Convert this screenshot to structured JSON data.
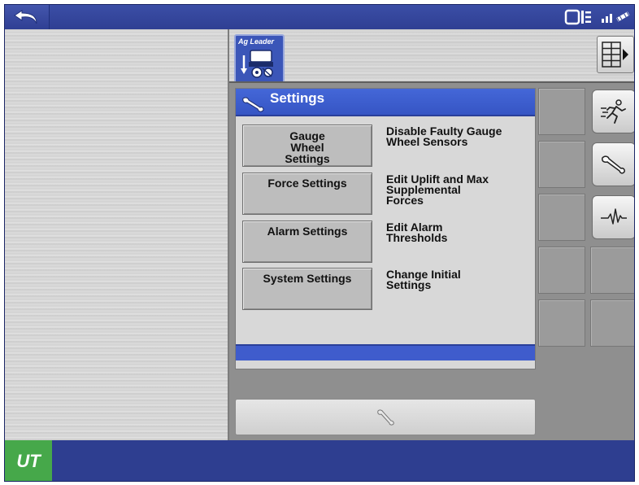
{
  "topbar": {
    "back_icon": "undo-arrow-icon",
    "status_icons": [
      "implement-status-icon",
      "gps-satellite-icon"
    ]
  },
  "ag_tab": {
    "logo_text": "Ag Leader",
    "icon": "planter-icon"
  },
  "grid_button": {
    "icon": "layout-grid-icon"
  },
  "settings": {
    "title": "Settings",
    "title_icon": "wrench-icon",
    "rows": [
      {
        "button_label": "Gauge Wheel Settings",
        "description": "Disable Faulty Gauge Wheel Sensors"
      },
      {
        "button_label": "Force Settings",
        "description": "Edit Uplift and Max Supplemental Forces"
      },
      {
        "button_label": "Alarm Settings",
        "description": "Edit Alarm Thresholds"
      },
      {
        "button_label": "System Settings",
        "description": "Change Initial Settings"
      }
    ]
  },
  "bottom_button": {
    "icon": "wrench-icon"
  },
  "side_buttons": [
    {
      "icon": "running-person-icon"
    },
    {
      "icon": "wrench-icon"
    },
    {
      "icon": "pulse-waveform-icon"
    }
  ],
  "bottombar": {
    "ut_label": "UT"
  },
  "colors": {
    "bar_blue": "#2e3e90",
    "header_blue": "#3f5ccc",
    "ut_green": "#46a84a"
  }
}
